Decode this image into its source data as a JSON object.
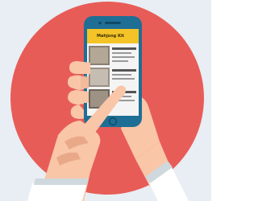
{
  "illustration": {
    "subject": "hand-holding-smartphone-with-finger-tapping-screen",
    "colors": {
      "background": "#e8eef3",
      "circle": "#e85c58",
      "phone_body": "#1f6e95",
      "phone_header": "#f3c328",
      "skin": "#f9c6a8",
      "skin_shadow": "#e9a989",
      "sleeve": "#ffffff",
      "cuff": "#cfd8dd"
    },
    "screen_header_text": "Mahjong Kit"
  }
}
